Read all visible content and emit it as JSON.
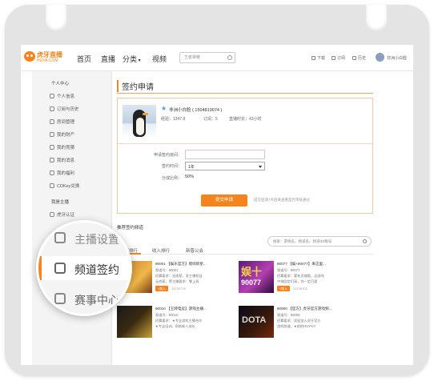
{
  "topbar": {
    "logo_text": "虎牙直播",
    "logo_sub": "HUYA.COM",
    "nav": [
      "首页",
      "直播",
      "分类",
      "视频"
    ],
    "search_placeholder": "王者荣耀",
    "actions": [
      "下载",
      "订阅",
      "历史"
    ],
    "username": "非洲小白脸"
  },
  "sidebar": {
    "sections": [
      {
        "title": "个人中心",
        "items": [
          "个人信息",
          "订阅与历史",
          "房间管理",
          "我的财产",
          "我的竞猜",
          "我的消息",
          "我的福利",
          "CDKey兑换"
        ]
      },
      {
        "title": "我是主播",
        "items": [
          "虎牙认证"
        ]
      }
    ]
  },
  "main": {
    "title": "签约申请",
    "profile": {
      "name": "非洲小白脸 ( 1504819074 )",
      "level": "经验：1347.8",
      "subs": "订阅：5",
      "time": "直播时长：43小时"
    },
    "form": {
      "room_label": "申请签约房间：",
      "period_label": "签约时间：",
      "period_value": "1年",
      "share_label": "分成比例：",
      "share_value": "50%",
      "submit_label": "提交申请",
      "note": "提交后请7天后来查看是否审核通过"
    },
    "recommend": {
      "title": "推荐签约频道",
      "tabs": [
        "人气排行",
        "收入排行",
        "新晋公会"
      ],
      "search_placeholder": "搜索：游戏名、频道名、频道ID/靓号"
    },
    "channels": [
      {
        "title": "90001 【娱乐官方】唱响新星...",
        "line1": "频道号：90001",
        "line2": "招募要求：无底薪，享主播权益",
        "line3": "无底薪，赞主播要求：零上线",
        "join": "+加入",
        "count": "14720776"
      },
      {
        "title": "90077 【娱+90077】来这里...",
        "line1": "频道号：90077",
        "line2": "招募要求：要有灵魂哦，这游戏",
        "line3": "中城固定们高，你一定可爱",
        "join": "+加入",
        "count": "13729702"
      },
      {
        "title": "90010 【王牌电竞】游戏主播...",
        "line1": "频道号：90010",
        "line2": "招募要求：★专业游戏主播合作",
        "line3": "★专业培训，帮助新人成长",
        "join": "+加入",
        "count": ""
      },
      {
        "title": "90000 【官方】虎牙官方游戏频...",
        "line1": "频道号：90000",
        "line2": "招募要求：欢迎加入虎牙官方",
        "line3": "游戏频道，★前的HUYA!!!",
        "join": "+加入",
        "count": ""
      }
    ],
    "thumb_text": [
      "娱十",
      "90077",
      "DOTA"
    ]
  },
  "magnifier": {
    "items": [
      "主播设置",
      "频道签约",
      "赛事中心"
    ]
  }
}
